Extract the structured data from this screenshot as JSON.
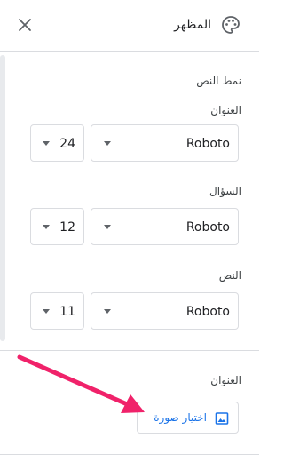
{
  "header": {
    "title": "المظهر"
  },
  "section_heading": "نمط النص",
  "rows": [
    {
      "label": "العنوان",
      "font": "Roboto",
      "size": "24"
    },
    {
      "label": "السؤال",
      "font": "Roboto",
      "size": "12"
    },
    {
      "label": "النص",
      "font": "Roboto",
      "size": "11"
    }
  ],
  "header_image": {
    "label": "العنوان",
    "button_label": "اختيار صورة"
  },
  "colors": {
    "accent": "#1a73e8",
    "annotation_arrow": "#f0226a",
    "border": "#dadce0"
  },
  "icons": {
    "close": "close-icon",
    "palette": "palette-icon",
    "image": "image-icon",
    "dropdown": "dropdown-caret-icon"
  }
}
